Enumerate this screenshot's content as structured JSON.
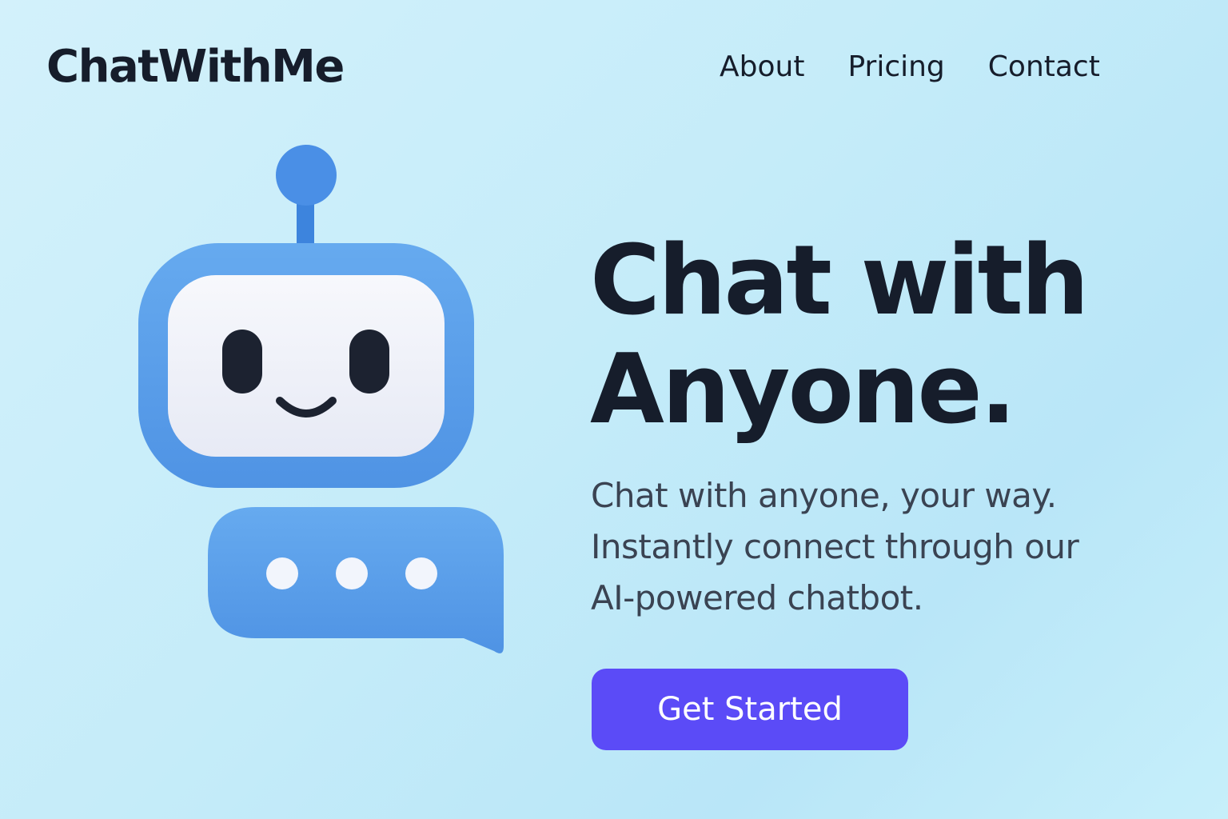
{
  "header": {
    "logo": "ChatWithMe",
    "nav": [
      {
        "label": "About"
      },
      {
        "label": "Pricing"
      },
      {
        "label": "Contact"
      }
    ]
  },
  "hero": {
    "headline_lines": [
      "Chat with",
      "Anyone."
    ],
    "subtext_lines": [
      "Chat with anyone, your way.",
      "Instantly connect through our",
      "AI-powered chatbot."
    ],
    "cta_label": "Get Started"
  },
  "illustration": {
    "robot-icon": "robot-mascot",
    "bubble-icon": "chat-bubble-typing",
    "colors": {
      "robot_blue": "#5a9ee9",
      "robot_blue_dark": "#3d84dd",
      "face": "#f1f3fb",
      "eyes": "#1c2230"
    }
  },
  "colors": {
    "background": "#c5ecf9",
    "text": "#161d2b",
    "subtext": "#3a4352",
    "accent": "#5b4bf7"
  }
}
